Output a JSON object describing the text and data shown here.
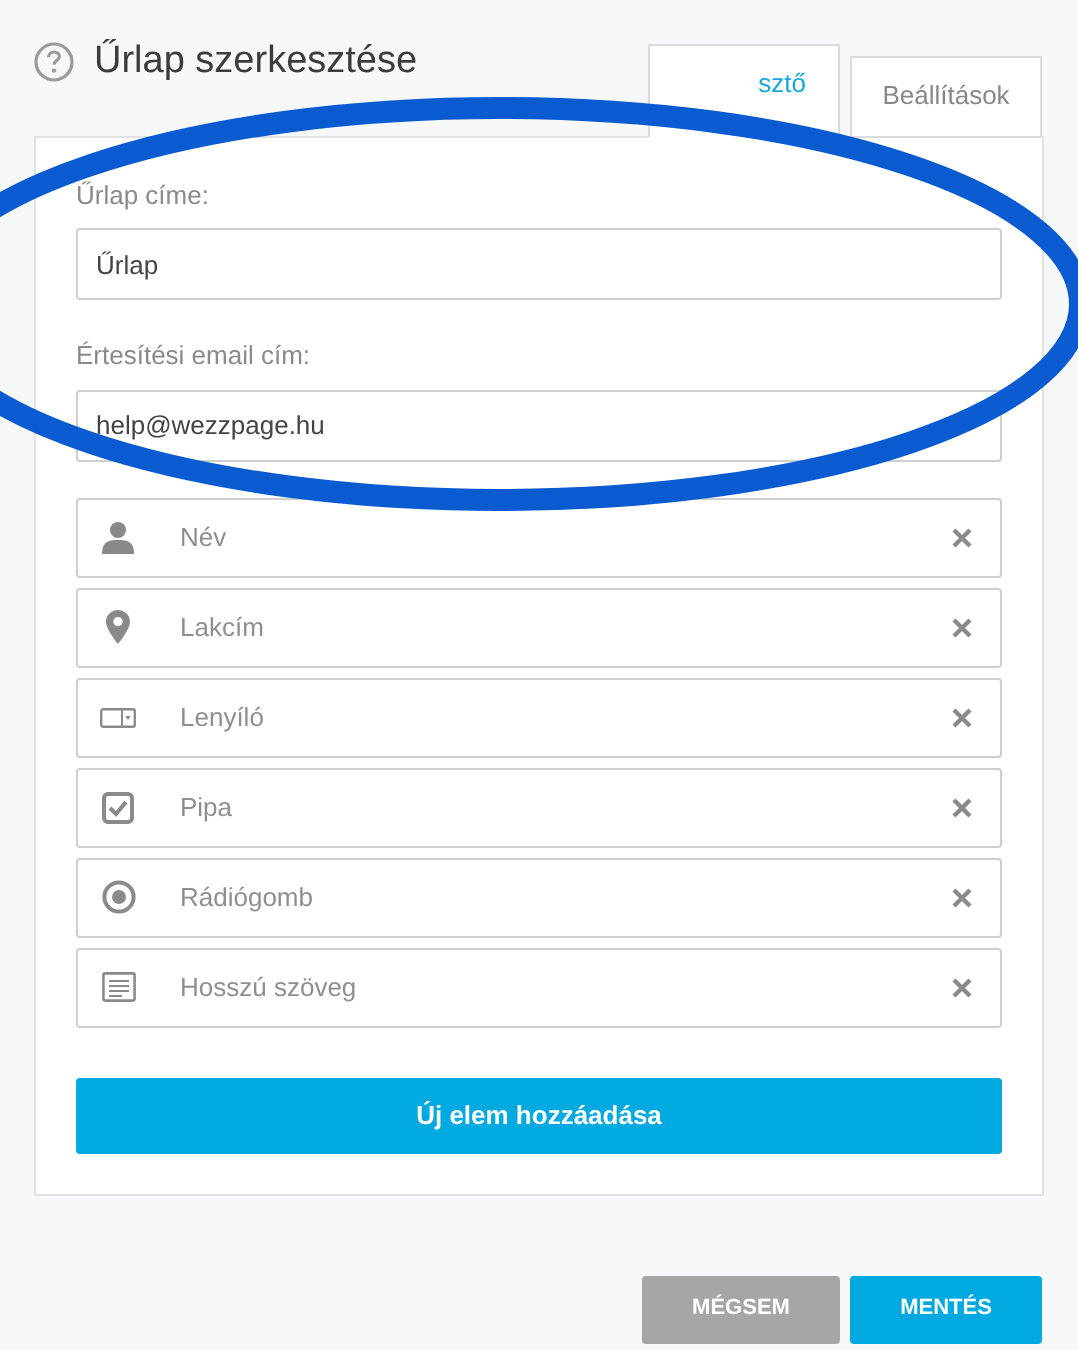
{
  "title": "Űrlap szerkesztése",
  "tabs": [
    {
      "label": "sztő",
      "selected": true
    },
    {
      "label": "Beállítások",
      "selected": false
    }
  ],
  "fields": [
    {
      "label": "Űrlap címe:",
      "value": "Űrlap"
    },
    {
      "label": "Értesítési email cím:",
      "value": "help@wezzpage.hu"
    }
  ],
  "elements": [
    {
      "kind": "person",
      "label": "Név"
    },
    {
      "kind": "pin",
      "label": "Lakcím"
    },
    {
      "kind": "dropdown",
      "label": "Lenyíló"
    },
    {
      "kind": "checkbox",
      "label": "Pipa"
    },
    {
      "kind": "radio",
      "label": "Rádiógomb"
    },
    {
      "kind": "textarea",
      "label": "Hosszú szöveg"
    }
  ],
  "add_button": "Új elem hozzáadása",
  "footer_buttons": [
    {
      "kind": "secondary",
      "label": "MÉGSEM"
    },
    {
      "kind": "primary",
      "label": "MENTÉS"
    }
  ],
  "annotation": {
    "kind": "ellipse",
    "color": "#0a5bd0"
  }
}
